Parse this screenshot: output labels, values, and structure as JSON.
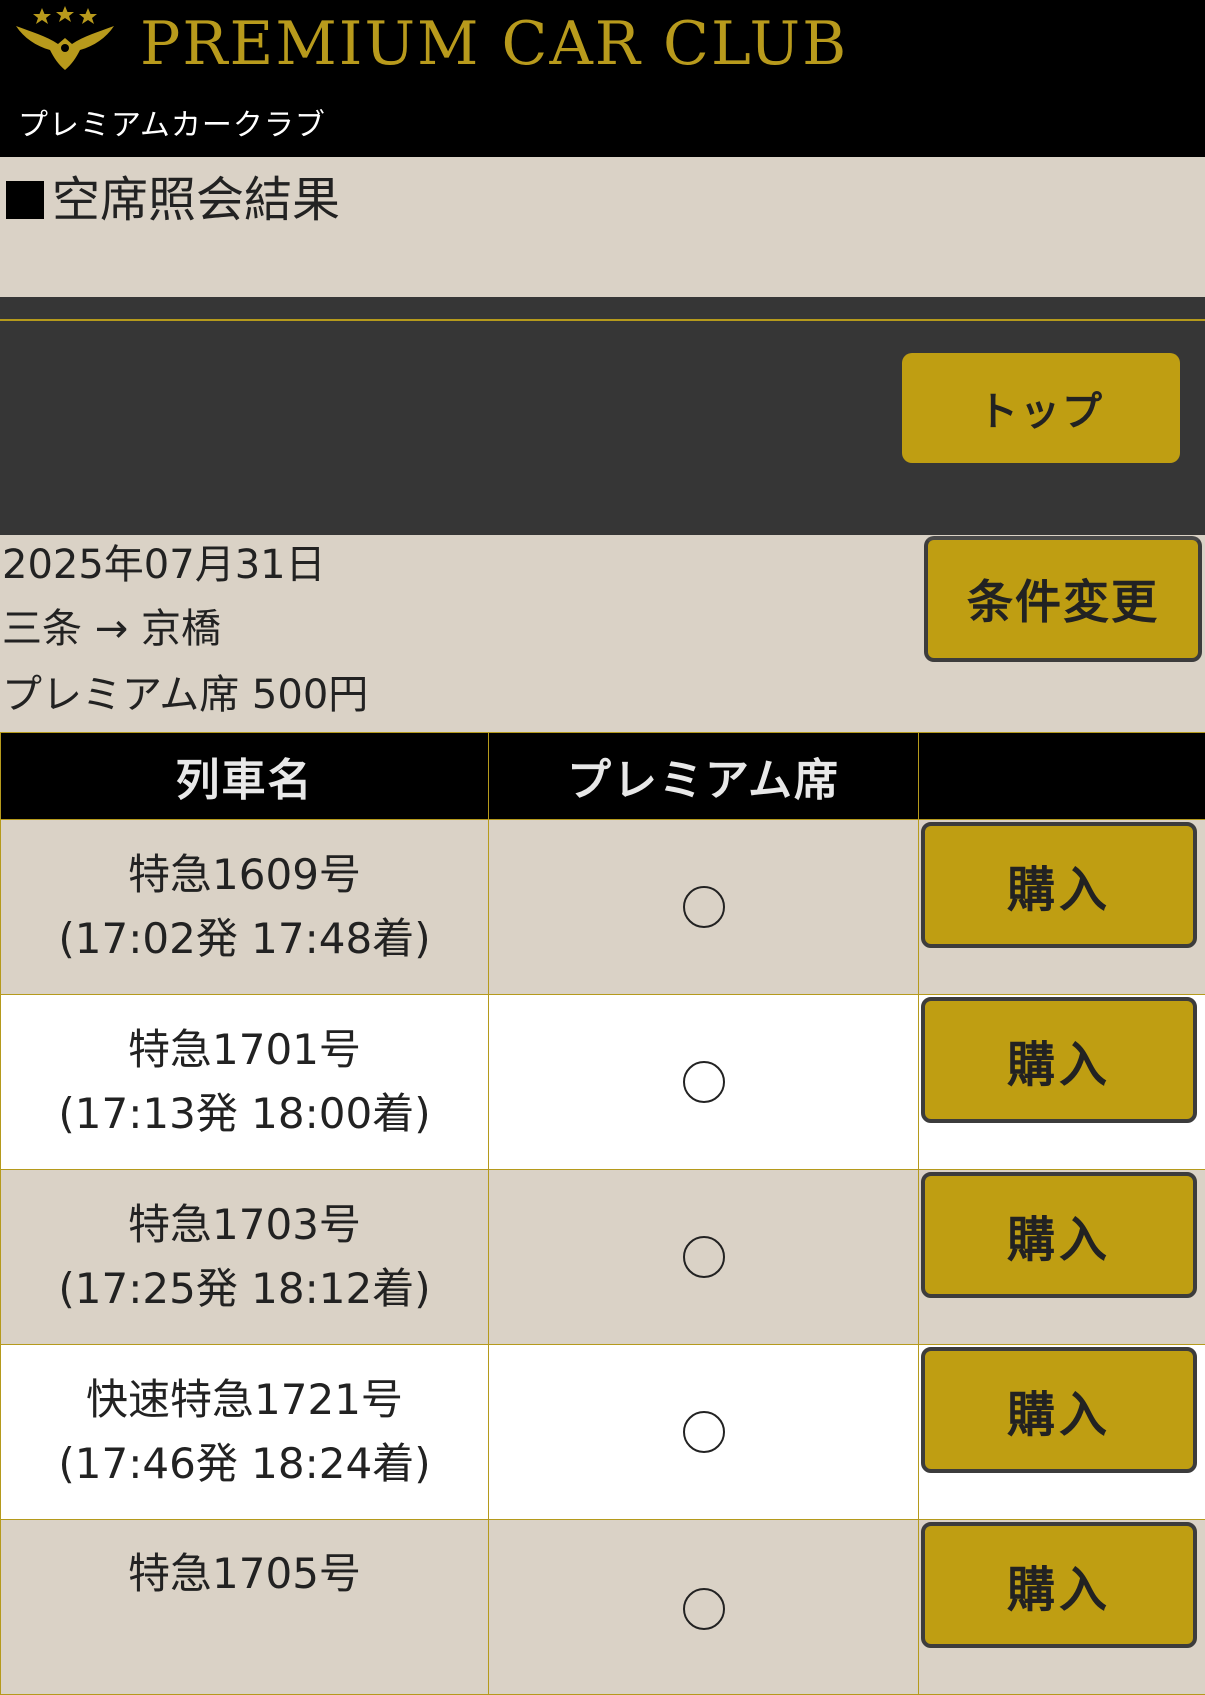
{
  "header": {
    "brand": "PREMIUM CAR CLUB",
    "brand_kana": "プレミアムカークラブ"
  },
  "page": {
    "title": "空席照会結果"
  },
  "nav": {
    "top_button": "トップ"
  },
  "search": {
    "date": "2025年07月31日",
    "route": "三条 → 京橋",
    "seat_class": "プレミアム席 500円",
    "change_button": "条件変更"
  },
  "table": {
    "headers": [
      "列車名",
      "プレミアム席",
      ""
    ],
    "rows": [
      {
        "name": "特急1609号",
        "times": "(17:02発 17:48着)",
        "availability": "○",
        "buy": "購入"
      },
      {
        "name": "特急1701号",
        "times": "(17:13発 18:00着)",
        "availability": "○",
        "buy": "購入"
      },
      {
        "name": "特急1703号",
        "times": "(17:25発 18:12着)",
        "availability": "○",
        "buy": "購入"
      },
      {
        "name": "快速特急1721号",
        "times": "(17:46発 18:24着)",
        "availability": "○",
        "buy": "購入"
      },
      {
        "name": "特急1705号",
        "times": "",
        "availability": "○",
        "buy": "購入"
      }
    ]
  },
  "colors": {
    "gold": "#bf9e12",
    "header_bg": "#000000",
    "beige": "#dad2c6",
    "dark_bar": "#363636"
  }
}
